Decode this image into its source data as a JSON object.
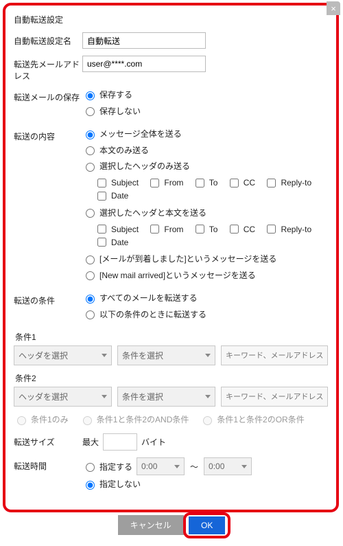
{
  "dialog": {
    "title": "自動転送設定",
    "close_icon": "×"
  },
  "fields": {
    "name_label": "自動転送設定名",
    "name_value": "自動転送",
    "to_label": "転送先メールアドレス",
    "to_value": "user@****.com",
    "save_label": "転送メールの保存",
    "save_opts": {
      "save": "保存する",
      "nosave": "保存しない"
    },
    "content_label": "転送の内容",
    "content_opts": {
      "whole": "メッセージ全体を送る",
      "body": "本文のみ送る",
      "sel_header": "選択したヘッダのみ送る",
      "sel_header_body": "選択したヘッダと本文を送る",
      "jp_msg": "[メールが到着しました]というメッセージを送る",
      "en_msg": "[New mail arrived]というメッセージを送る"
    },
    "header_checks": {
      "subject": "Subject",
      "from": "From",
      "to": "To",
      "cc": "CC",
      "replyto": "Reply-to",
      "date": "Date"
    },
    "cond_label": "転送の条件",
    "cond_opts": {
      "all": "すべてのメールを転送する",
      "when": "以下の条件のときに転送する"
    },
    "cond1_title": "条件1",
    "cond2_title": "条件2",
    "select_header_ph": "ヘッダを選択",
    "select_cond_ph": "条件を選択",
    "keyword_ph": "キーワード、メールアドレスなどの条件",
    "logic": {
      "only1": "条件1のみ",
      "and": "条件1と条件2のAND条件",
      "or": "条件1と条件2のOR条件"
    },
    "size_label": "転送サイズ",
    "size_max": "最大",
    "size_unit": "バイト",
    "time_label": "転送時間",
    "time_specify": "指定する",
    "time_nospecify": "指定しない",
    "time_from": "0:00",
    "time_to": "0:00"
  },
  "buttons": {
    "cancel": "キャンセル",
    "ok": "OK"
  }
}
